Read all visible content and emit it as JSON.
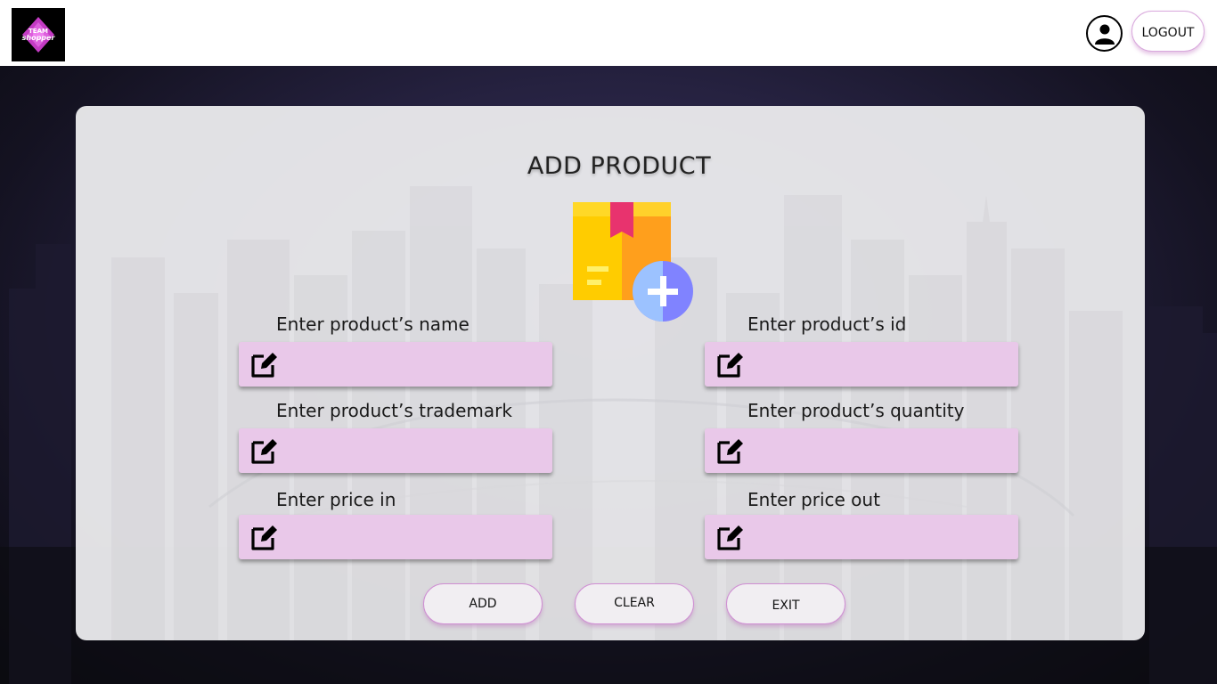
{
  "header": {
    "logo_line1": "TEAM",
    "logo_line2": "shopper",
    "logout_label": "LOGOUT"
  },
  "icons": {
    "user": "user-circle-icon",
    "edit": "edit-square-icon",
    "product": "box-add-icon"
  },
  "form": {
    "title": "ADD PRODUCT",
    "fields": [
      {
        "label": "Enter product’s name",
        "value": ""
      },
      {
        "label": "Enter product’s id",
        "value": ""
      },
      {
        "label": "Enter product’s trademark",
        "value": ""
      },
      {
        "label": "Enter product’s quantity",
        "value": ""
      },
      {
        "label": "Enter price in",
        "value": ""
      },
      {
        "label": "Enter price out",
        "value": ""
      }
    ],
    "buttons": {
      "add": "ADD",
      "clear": "CLEAR",
      "exit": "EXIT"
    }
  },
  "colors": {
    "field_bg": "#e9c8e9",
    "button_border": "#cf8fd3",
    "background_dark": "#25213f"
  }
}
